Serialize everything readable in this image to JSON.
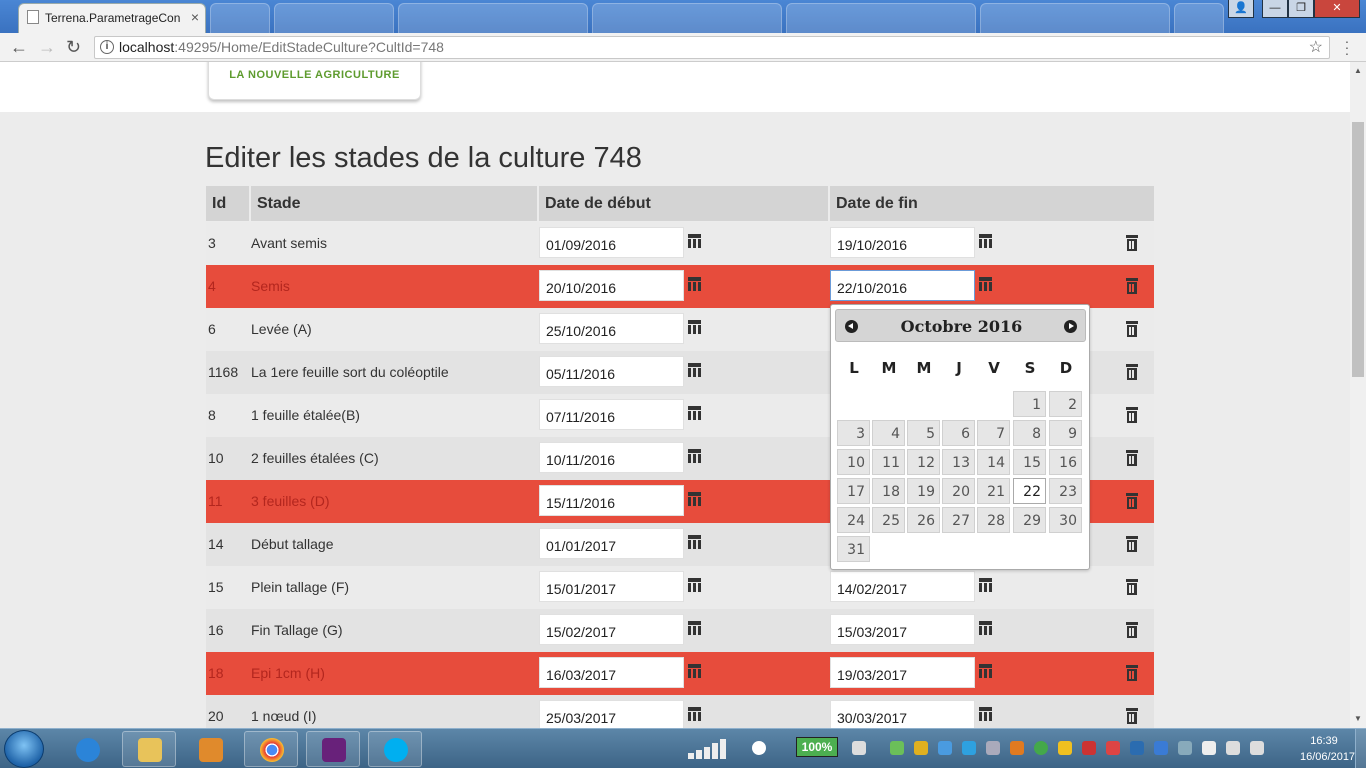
{
  "browser": {
    "tab_title": "Terrena.ParametrageCon",
    "tab_close": "×",
    "url_host": "localhost",
    "url_rest": ":49295/Home/EditStadeCulture?CultId=748",
    "back": "←",
    "forward": "→",
    "reload": "↻",
    "star": "☆",
    "info": "i",
    "window": {
      "user": "👤",
      "minimize": "—",
      "maximize": "❐",
      "close": "✕"
    }
  },
  "logo": {
    "text": "LA NOUVELLE AGRICULTURE"
  },
  "page": {
    "title": "Editer les stades de la culture 748"
  },
  "table": {
    "headers": {
      "id": "Id",
      "stade": "Stade",
      "debut": "Date de début",
      "fin": "Date de fin"
    },
    "rows": [
      {
        "id": "3",
        "stade": "Avant semis",
        "debut": "01/09/2016",
        "fin": "19/10/2016",
        "highlight": false
      },
      {
        "id": "4",
        "stade": "Semis",
        "debut": "20/10/2016",
        "fin": "22/10/2016",
        "highlight": true
      },
      {
        "id": "6",
        "stade": "Levée (A)",
        "debut": "25/10/2016",
        "fin": "",
        "highlight": false
      },
      {
        "id": "1168",
        "stade": "La 1ere feuille sort du coléoptile",
        "debut": "05/11/2016",
        "fin": "",
        "highlight": false
      },
      {
        "id": "8",
        "stade": "1 feuille étalée(B)",
        "debut": "07/11/2016",
        "fin": "",
        "highlight": false
      },
      {
        "id": "10",
        "stade": "2 feuilles étalées (C)",
        "debut": "10/11/2016",
        "fin": "",
        "highlight": false
      },
      {
        "id": "11",
        "stade": "3 feuilles (D)",
        "debut": "15/11/2016",
        "fin": "",
        "highlight": true
      },
      {
        "id": "14",
        "stade": "Début tallage",
        "debut": "01/01/2017",
        "fin": "",
        "highlight": false
      },
      {
        "id": "15",
        "stade": "Plein tallage (F)",
        "debut": "15/01/2017",
        "fin": "14/02/2017",
        "highlight": false
      },
      {
        "id": "16",
        "stade": "Fin Tallage (G)",
        "debut": "15/02/2017",
        "fin": "15/03/2017",
        "highlight": false
      },
      {
        "id": "18",
        "stade": "Epi 1cm (H)",
        "debut": "16/03/2017",
        "fin": "19/03/2017",
        "highlight": true
      },
      {
        "id": "20",
        "stade": "1 nœud (I)",
        "debut": "25/03/2017",
        "fin": "30/03/2017",
        "highlight": false
      }
    ]
  },
  "datepicker": {
    "title": "Octobre 2016",
    "weekdays": [
      "L",
      "M",
      "M",
      "J",
      "V",
      "S",
      "D"
    ],
    "weeks": [
      [
        "",
        "",
        "",
        "",
        "",
        "1",
        "2"
      ],
      [
        "3",
        "4",
        "5",
        "6",
        "7",
        "8",
        "9"
      ],
      [
        "10",
        "11",
        "12",
        "13",
        "14",
        "15",
        "16"
      ],
      [
        "17",
        "18",
        "19",
        "20",
        "21",
        "22",
        "23"
      ],
      [
        "24",
        "25",
        "26",
        "27",
        "28",
        "29",
        "30"
      ],
      [
        "31",
        "",
        "",
        "",
        "",
        "",
        ""
      ]
    ],
    "selected": "22"
  },
  "taskbar": {
    "battery": "100%",
    "time": "16:39",
    "date": "16/06/2017"
  },
  "colors": {
    "highlight_row": "#e74c3c",
    "logo_green": "#5e9b2e",
    "taskbar": "#3d6486"
  },
  "icons": [
    "calendar-icon",
    "trash-icon",
    "chevron-left-icon",
    "chevron-right-icon"
  ]
}
